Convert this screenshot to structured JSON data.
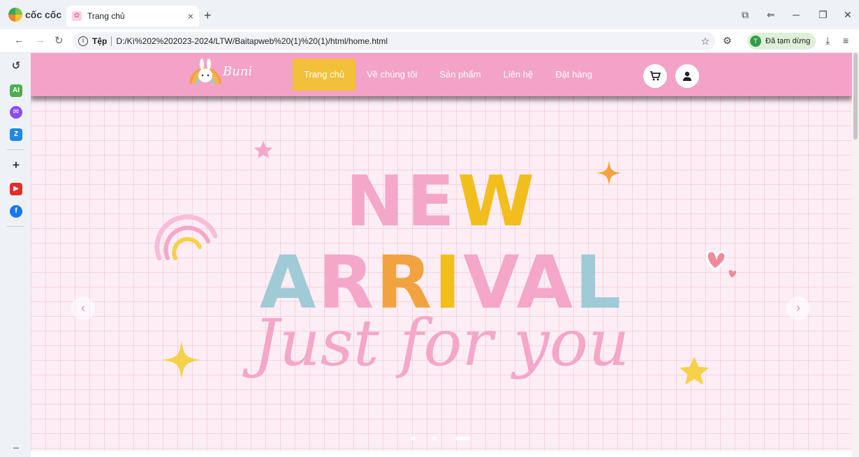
{
  "browser": {
    "brand": "cốc cốc",
    "tab_title": "Trang chủ",
    "tab_close": "×",
    "new_tab": "+",
    "address_label": "Tệp",
    "url": "D:/Kì%202%202023-2024/LTW/Baitapweb%20(1)%20(1)/html/home.html",
    "profile_initial": "T",
    "profile_status": "Đã tạm dừng",
    "sidebar_more": "..."
  },
  "site": {
    "logo_text": "Buni",
    "nav": [
      "Trang chủ",
      "Về chúng tôi",
      "Sản phẩm",
      "Liên hệ",
      "Đặt hàng"
    ],
    "active_nav": "Trang chủ"
  },
  "banner": {
    "line1": "NEW",
    "line2": "ARRIVAL",
    "line3": "Just for you",
    "line1_colors": [
      "#f4a7c9",
      "#f4a7c9",
      "#f2be1e"
    ],
    "line2_colors": [
      "#9fcbd6",
      "#f4a7c9",
      "#f2a33f",
      "#f2be1e",
      "#f4a7c9",
      "#f4a7c9",
      "#9fcbd6"
    ],
    "prev": "‹",
    "next": "›",
    "slide_count": 3,
    "active_slide": 3
  },
  "colors": {
    "header_pink": "#f3a2c8",
    "active_yellow": "#f3c03a",
    "banner_bg": "#fdeef5"
  }
}
